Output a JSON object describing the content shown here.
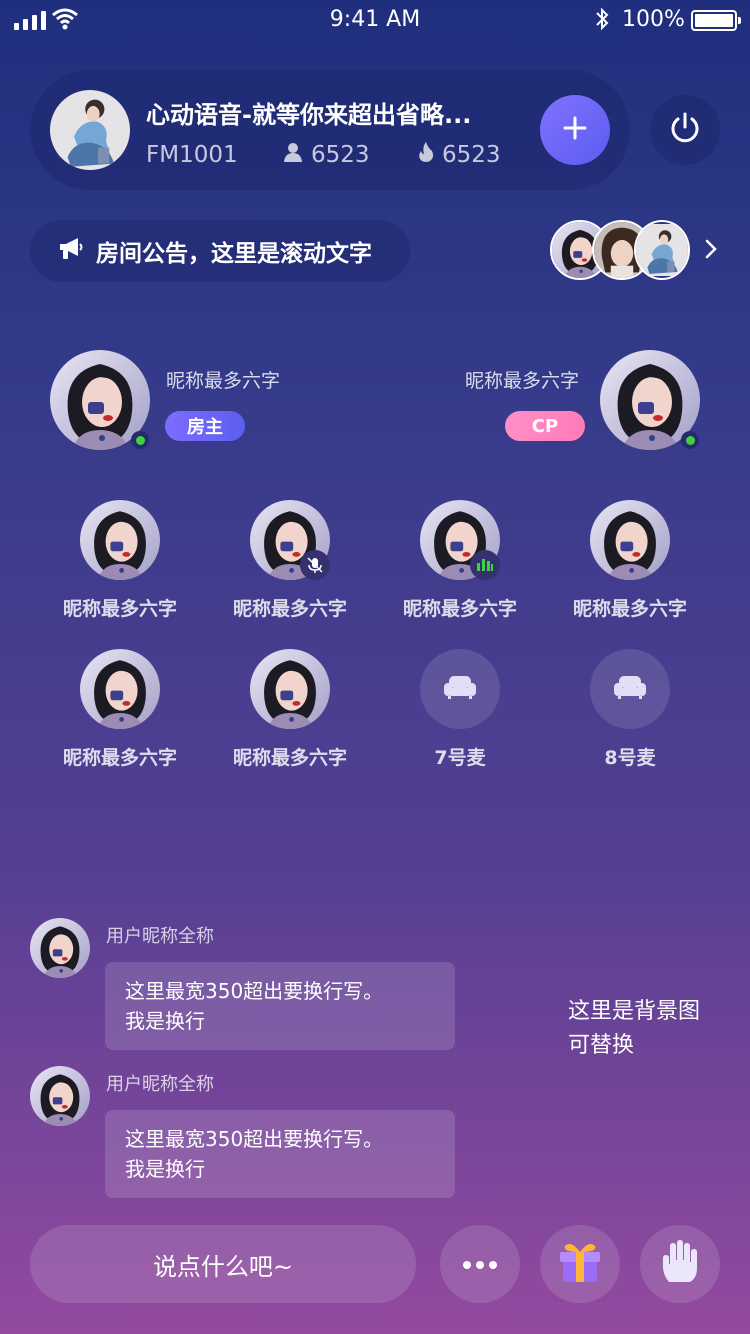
{
  "status_bar": {
    "time": "9:41 AM",
    "battery_percent": "100%",
    "icons": [
      "signal-icon",
      "wifi-icon",
      "bluetooth-icon",
      "battery-icon"
    ]
  },
  "room": {
    "title": "心动语音-就等你来超出省略...",
    "id": "FM1001",
    "members_count": "6523",
    "heat_count": "6523",
    "icons": [
      "user-icon",
      "flame-icon",
      "plus-icon",
      "power-icon"
    ]
  },
  "notice": {
    "text": "房间公告，这里是滚动文字"
  },
  "top_seats": {
    "host": {
      "name": "昵称最多六字",
      "badge": "房主",
      "online": true
    },
    "cp": {
      "name": "昵称最多六字",
      "badge": "CP",
      "online": true
    }
  },
  "mics": [
    {
      "label": "昵称最多六字",
      "occupied": true,
      "status": "none"
    },
    {
      "label": "昵称最多六字",
      "occupied": true,
      "status": "muted"
    },
    {
      "label": "昵称最多六字",
      "occupied": true,
      "status": "speaking"
    },
    {
      "label": "昵称最多六字",
      "occupied": true,
      "status": "none"
    },
    {
      "label": "昵称最多六字",
      "occupied": true,
      "status": "none"
    },
    {
      "label": "昵称最多六字",
      "occupied": true,
      "status": "none"
    },
    {
      "label": "7号麦",
      "occupied": false,
      "status": "empty"
    },
    {
      "label": "8号麦",
      "occupied": false,
      "status": "empty"
    }
  ],
  "chat": [
    {
      "name": "用户昵称全称",
      "line1": "这里最宽350超出要换行写。",
      "line2": "我是换行"
    },
    {
      "name": "用户昵称全称",
      "line1": "这里最宽350超出要换行写。",
      "line2": "我是换行"
    }
  ],
  "background_note": {
    "line1": "这里是背景图",
    "line2": "可替换"
  },
  "bottom_bar": {
    "input_placeholder": "说点什么吧~",
    "icons": [
      "more-icon",
      "gift-icon",
      "raise-hand-icon"
    ]
  },
  "colors": {
    "accent": "#6b66f6",
    "cp_pink": "#ff86bf",
    "online_green": "#3fd23f"
  }
}
